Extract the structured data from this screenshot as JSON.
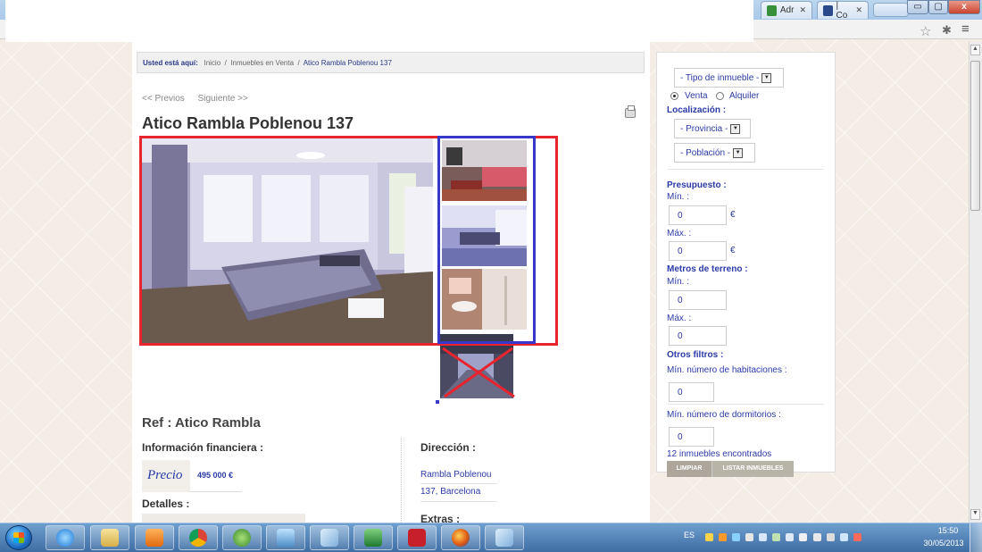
{
  "browser": {
    "tabs": [
      {
        "label": "Adr",
        "color": "#3a8f3a"
      },
      {
        "label": "| Co",
        "color": "#2a4a8a"
      }
    ],
    "window_controls": {
      "minimize": "▭",
      "maximize": "▢",
      "close": "x"
    },
    "icons": {
      "star": "star-icon",
      "extension": "wrench-icon",
      "menu": "menu-icon"
    }
  },
  "breadcrumb": {
    "prefix": "Usted está aquí:",
    "items": [
      "Inicio",
      "Inmuebles en Venta",
      "Atico Rambla Poblenou 137"
    ],
    "separator": "/"
  },
  "nav": {
    "previous": "<< Previos",
    "next": "Siguiente >>"
  },
  "property": {
    "title": "Atico Rambla Poblenou 137",
    "ref": "Ref : Atico Rambla",
    "financial_heading": "Información financiera :",
    "price_label": "Precio",
    "price_value": "495 000 €",
    "details_heading": "Detalles :",
    "address_heading": "Dirección :",
    "address_line1": "Rambla Poblenou",
    "address_line2": "137, Barcelona",
    "extras_heading": "Extras :"
  },
  "annotation_colors": {
    "red_box": "#e8242e",
    "blue_box": "#3838c8"
  },
  "search": {
    "type_select": "- Tipo de inmueble -",
    "radio_venta": "Venta",
    "radio_alquiler": "Alquiler",
    "radio_selected": "Venta",
    "location_heading": "Localización :",
    "province_select": "- Provincia -",
    "town_select": "- Población -",
    "budget_heading": "Presupuesto :",
    "min_label": "Mín. :",
    "max_label": "Máx. :",
    "budget_min": "0",
    "budget_max": "0",
    "currency": "€",
    "land_heading": "Metros de terreno :",
    "land_min": "0",
    "land_max": "0",
    "other_heading": "Otros filtros :",
    "rooms_label": "Mín. número de habitaciones :",
    "rooms_value": "0",
    "bedrooms_label": "Mín. número de dormitorios :",
    "bedrooms_value": "0",
    "results": "12 inmuebles encontrados",
    "clear_button": "LIMPIAR",
    "list_button": "LISTAR INMUEBLES"
  },
  "taskbar": {
    "language": "ES",
    "time": "15:50",
    "date": "30/05/2013"
  }
}
